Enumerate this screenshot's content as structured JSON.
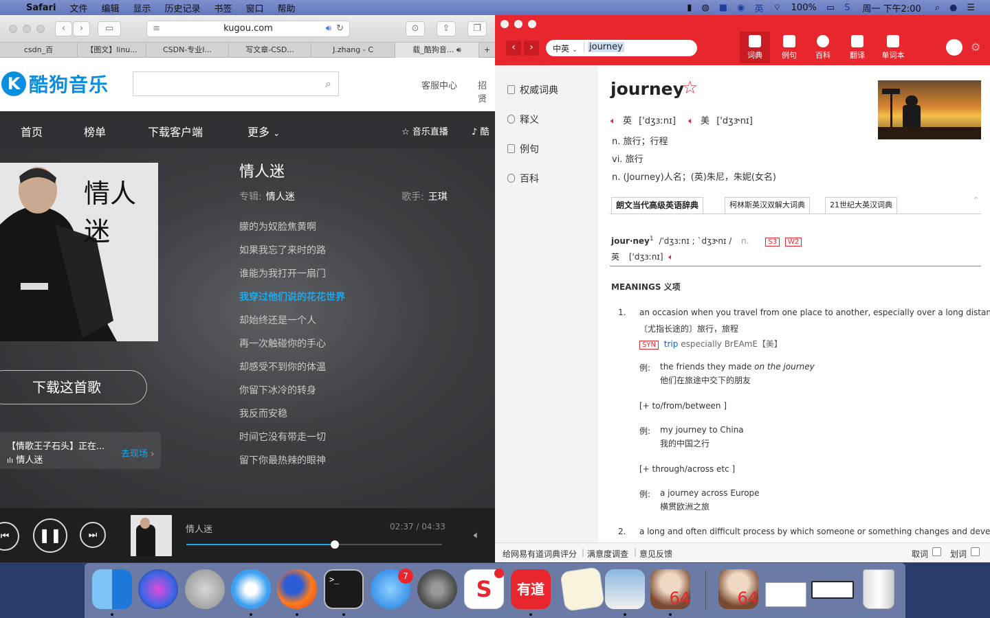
{
  "menubar": {
    "app": "Safari",
    "items": [
      "文件",
      "编辑",
      "显示",
      "历史记录",
      "书签",
      "窗口",
      "帮助"
    ],
    "battery": "100%",
    "clock": "周一 下午2:00"
  },
  "safari": {
    "url": "kugou.com",
    "tabs": [
      "csdn_百",
      "【图文】linu...",
      "CSDN-专业I...",
      "写文章-CSD...",
      "J.zhang - C",
      "载_酷狗音..."
    ],
    "add_tab": "+"
  },
  "kugou": {
    "logo_letter": "K",
    "logo_text": "酷狗音乐",
    "header_links": [
      "客服中心",
      "招贤"
    ],
    "nav": [
      "首页",
      "榜单",
      "下载客户端",
      "更多"
    ],
    "nav_right": [
      "音乐直播",
      "酷"
    ],
    "song_title": "情人迷",
    "album_label": "专辑:",
    "album": "情人迷",
    "singer_label": "歌手:",
    "singer": "王琪",
    "cover_text": "情人迷",
    "lyrics": [
      "朦的为奴脸焦黄啊",
      "如果我忘了来时的路",
      "谁能为我打开一扇门",
      "我穿过他们说的花花世界",
      "却始终还是一个人",
      "再一次触碰你的手心",
      "却感受不到你的体温",
      "你留下冰冷的转身",
      "我反而安稳",
      "时间它没有带走一切",
      "留下你最热辣的眼神"
    ],
    "active_lyric": 3,
    "download_btn": "下载这首歌",
    "live_title": "【情歌王子石头】正在...",
    "live_song": "情人迷",
    "live_link": "去现场",
    "player": {
      "track": "情人迷",
      "time": "02:37 / 04:33",
      "progress": 0.58
    }
  },
  "youdao": {
    "lang": "中英",
    "query": "journey",
    "tabs": [
      "词典",
      "例句",
      "百科",
      "翻译",
      "单词本"
    ],
    "sidebar": [
      "权威词典",
      "释义",
      "例句",
      "百科"
    ],
    "word": "journey",
    "uk_label": "英",
    "uk_phon": "['dʒɜːnɪ]",
    "us_label": "美",
    "us_phon": "['dʒɝnɪ]",
    "defs": [
      "n. 旅行；行程",
      "vi. 旅行",
      "n. (Journey)人名；(英)朱尼，朱妮(女名)"
    ],
    "dict_tabs": [
      "朗文当代高级英语辞典",
      "柯林斯英汉双解大词典",
      "21世纪大英汉词典"
    ],
    "entry_head": "jour·ney",
    "entry_sup": "1",
    "entry_phon": "/ˈdʒɜːnɪ ; ˋdʒɝnɪ /",
    "entry_pos": "n.",
    "badges": [
      "S3",
      "W2"
    ],
    "entry_uk": "英",
    "entry_uk_phon": "['dʒɜːnɪ]",
    "meanings_title": "MEANINGS 义项",
    "m1_num": "1.",
    "m1_en": "an occasion when you travel from one place to another, especially over a long distance",
    "m1_cn": "〔尤指长途的〕旅行，旅程",
    "syn_badge": "SYN",
    "syn_word": "trip",
    "syn_rest": "especially BrEAmE【美】",
    "ex_label": "例:",
    "ex1_en_a": "the friends they made ",
    "ex1_en_b": "on the journey",
    "ex1_cn": "他们在旅途中交下的朋友",
    "pattern1": "[+ to/from/between ]",
    "ex2_en": "my journey to China",
    "ex2_cn": "我的中国之行",
    "pattern2": "[+ through/across etc ]",
    "ex3_en": "a journey across Europe",
    "ex3_cn": "横贯欧洲之旅",
    "m2_num": "2.",
    "m2_en": "a long and often difficult process by which someone or something changes and develops",
    "footer_links": [
      "给网易有道词典评分",
      "满意度调查",
      "意见反馈"
    ],
    "footer_right": [
      "取词",
      "划词"
    ]
  },
  "dock": {
    "badge": "7",
    "apps": [
      "finder-icon",
      "siri-icon",
      "launchpad-icon",
      "safari-icon",
      "firefox-icon",
      "terminal-icon",
      "app-store-icon",
      "system-preferences-icon",
      "sogou-icon",
      "youdao-icon",
      "textedit-icon",
      "preview-icon",
      "portrait-icon",
      "portrait2-icon",
      "doc-thumb-icon",
      "window-thumb-icon",
      "trash-icon"
    ],
    "youdao_text": "有道",
    "terminal_text": ">_",
    "portrait_num": "64"
  }
}
